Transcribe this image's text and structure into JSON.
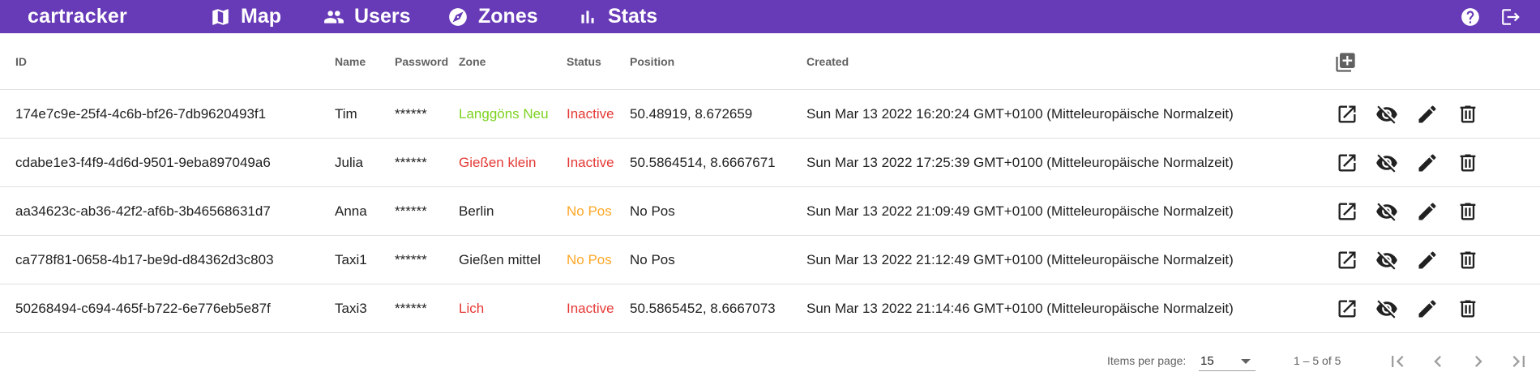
{
  "app": {
    "brand": "cartracker",
    "nav": [
      {
        "label": "Map",
        "icon": "map-icon"
      },
      {
        "label": "Users",
        "icon": "users-icon"
      },
      {
        "label": "Zones",
        "icon": "compass-icon"
      },
      {
        "label": "Stats",
        "icon": "bar-chart-icon"
      }
    ],
    "actions": [
      {
        "icon": "help-icon"
      },
      {
        "icon": "logout-icon"
      }
    ],
    "theme": {
      "primary": "#673ab7",
      "status_inactive": "#e53935",
      "status_nopos": "#ffa726",
      "zone_green": "#7cd21f",
      "zone_red": "#e53935"
    }
  },
  "table": {
    "headers": {
      "id": "ID",
      "name": "Name",
      "password": "Password",
      "zone": "Zone",
      "status": "Status",
      "position": "Position",
      "created": "Created"
    },
    "add_icon": "add-box-icon",
    "rows": [
      {
        "id": "174e7c9e-25f4-4c6b-bf26-7db9620493f1",
        "name": "Tim",
        "password": "******",
        "zone": "Langgöns Neu",
        "zone_color": "#7cd21f",
        "status": "Inactive",
        "status_color": "#e53935",
        "position": "50.48919, 8.672659",
        "created": "Sun Mar 13 2022 16:20:24 GMT+0100 (Mitteleuropäische Normalzeit)"
      },
      {
        "id": "cdabe1e3-f4f9-4d6d-9501-9eba897049a6",
        "name": "Julia",
        "password": "******",
        "zone": "Gießen klein",
        "zone_color": "#e53935",
        "status": "Inactive",
        "status_color": "#e53935",
        "position": "50.5864514, 8.6667671",
        "created": "Sun Mar 13 2022 17:25:39 GMT+0100 (Mitteleuropäische Normalzeit)"
      },
      {
        "id": "aa34623c-ab36-42f2-af6b-3b46568631d7",
        "name": "Anna",
        "password": "******",
        "zone": "Berlin",
        "zone_color": "#212121",
        "status": "No Pos",
        "status_color": "#ffa726",
        "position": "No Pos",
        "created": "Sun Mar 13 2022 21:09:49 GMT+0100 (Mitteleuropäische Normalzeit)"
      },
      {
        "id": "ca778f81-0658-4b17-be9d-d84362d3c803",
        "name": "Taxi1",
        "password": "******",
        "zone": "Gießen mittel",
        "zone_color": "#212121",
        "status": "No Pos",
        "status_color": "#ffa726",
        "position": "No Pos",
        "created": "Sun Mar 13 2022 21:12:49 GMT+0100 (Mitteleuropäische Normalzeit)"
      },
      {
        "id": "50268494-c694-465f-b722-6e776eb5e87f",
        "name": "Taxi3",
        "password": "******",
        "zone": "Lich",
        "zone_color": "#e53935",
        "status": "Inactive",
        "status_color": "#e53935",
        "position": "50.5865452, 8.6667073",
        "created": "Sun Mar 13 2022 21:14:46 GMT+0100 (Mitteleuropäische Normalzeit)"
      }
    ],
    "row_actions": [
      "open-in-new-icon",
      "visibility-off-icon",
      "edit-icon",
      "delete-icon"
    ]
  },
  "paginator": {
    "items_per_page_label": "Items per page:",
    "page_size": "15",
    "range_label": "1 – 5 of 5"
  }
}
